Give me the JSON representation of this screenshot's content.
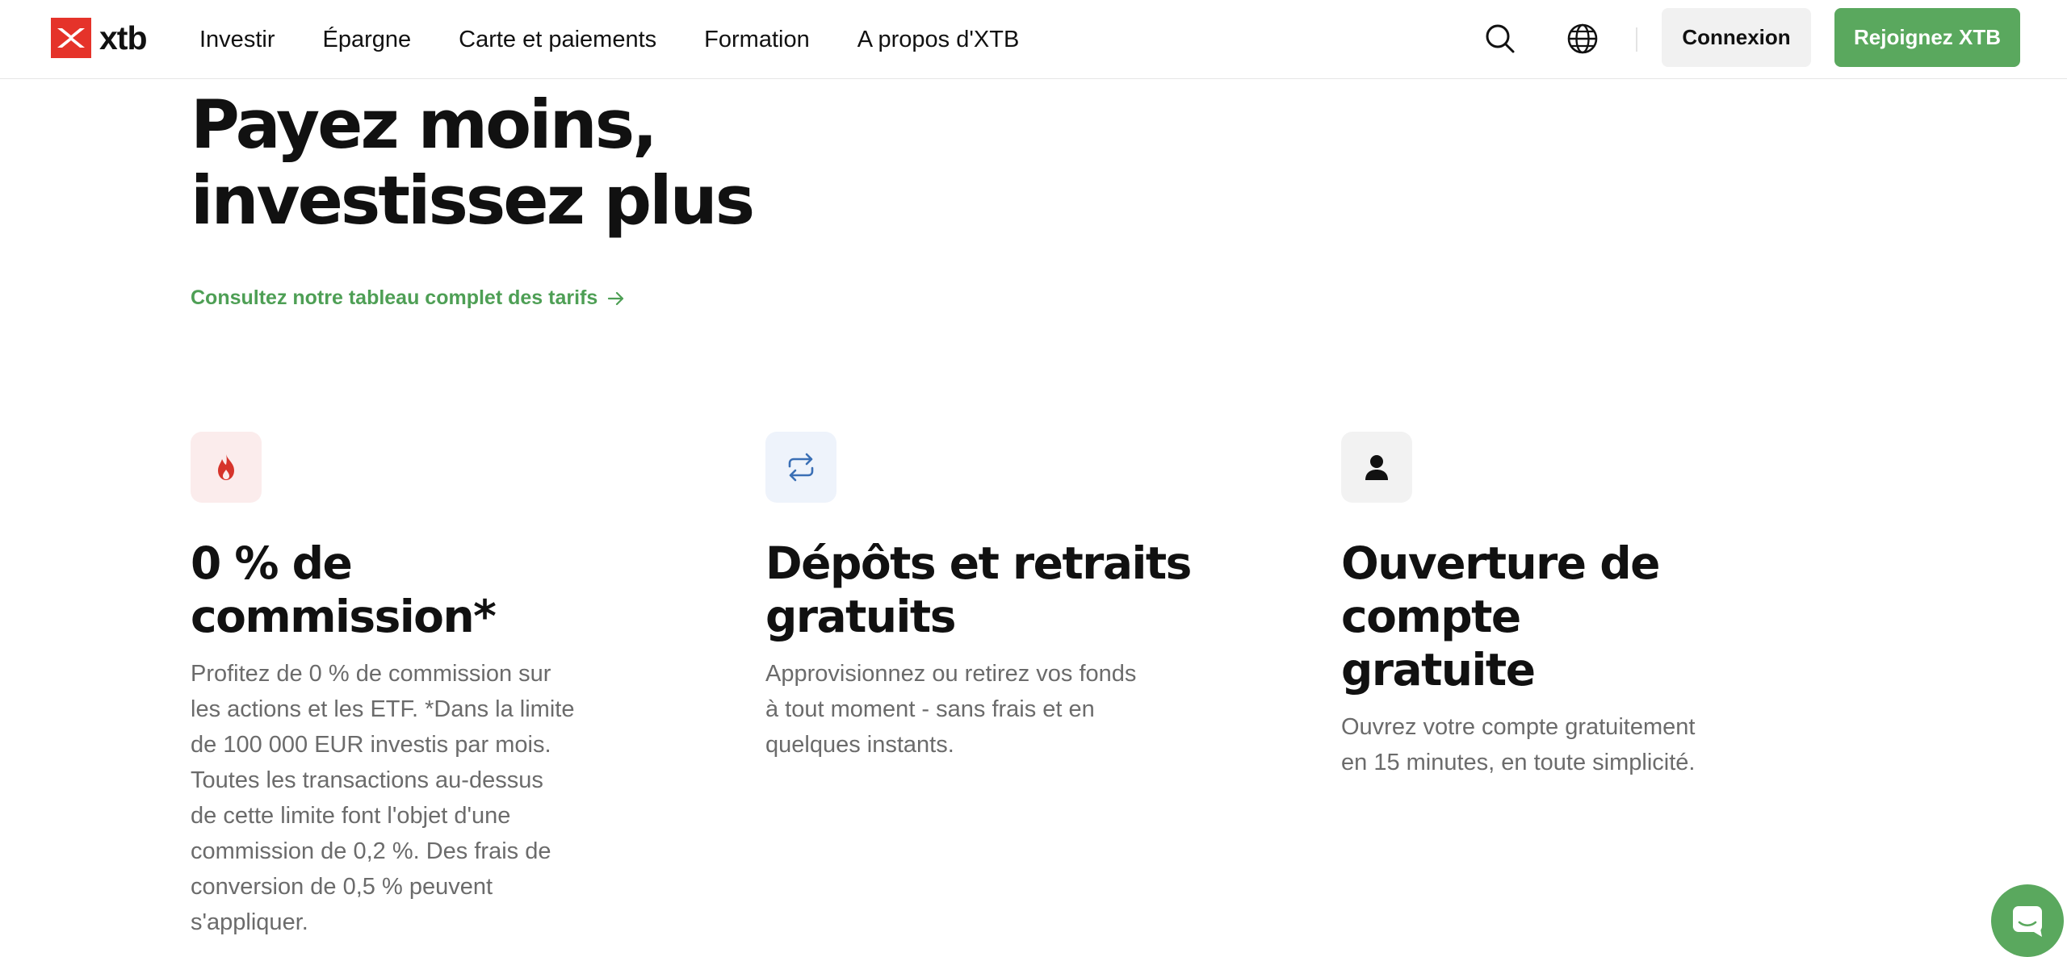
{
  "brand": {
    "name": "xtb",
    "logo_color": "#e5332a"
  },
  "nav": {
    "items": [
      {
        "label": "Investir"
      },
      {
        "label": "Épargne"
      },
      {
        "label": "Carte et paiements"
      },
      {
        "label": "Formation"
      },
      {
        "label": "A propos d'XTB"
      }
    ],
    "search_icon": "search-icon",
    "language_icon": "globe-icon",
    "login_label": "Connexion",
    "join_label": "Rejoignez XTB"
  },
  "hero": {
    "title_line1": "Payez moins,",
    "title_line2": "investissez plus",
    "link_label": "Consultez notre tableau complet des tarifs"
  },
  "features": [
    {
      "icon": "flame-icon",
      "icon_bg": "#fbecec",
      "icon_color": "#e5332a",
      "title": "0 % de commission*",
      "description": "Profitez de 0 % de commission sur\nles actions et les ETF. *Dans la limite\nde 100 000 EUR investis par mois.\nToutes les transactions au-dessus\nde cette limite font l'objet d'une\ncommission de 0,2 %. Des frais de\nconversion de 0,5 % peuvent\ns'appliquer."
    },
    {
      "icon": "repeat-arrows-icon",
      "icon_bg": "#eef3fb",
      "icon_color": "#3a6fb5",
      "title": "Dépôts et retraits\ngratuits",
      "description": "Approvisionnez ou retirez vos fonds\nà tout moment - sans frais et en\nquelques instants."
    },
    {
      "icon": "user-icon",
      "icon_bg": "#f2f2f2",
      "icon_color": "#111111",
      "title": "Ouverture de compte\ngratuite",
      "description": "Ouvrez votre compte gratuitement\nen 15 minutes, en toute simplicité."
    }
  ],
  "chat": {
    "icon": "chat-icon",
    "color": "#5aa85e"
  },
  "colors": {
    "accent_green": "#5aa85e",
    "link_green": "#4e9f55",
    "text_muted": "#6b6b6b"
  }
}
